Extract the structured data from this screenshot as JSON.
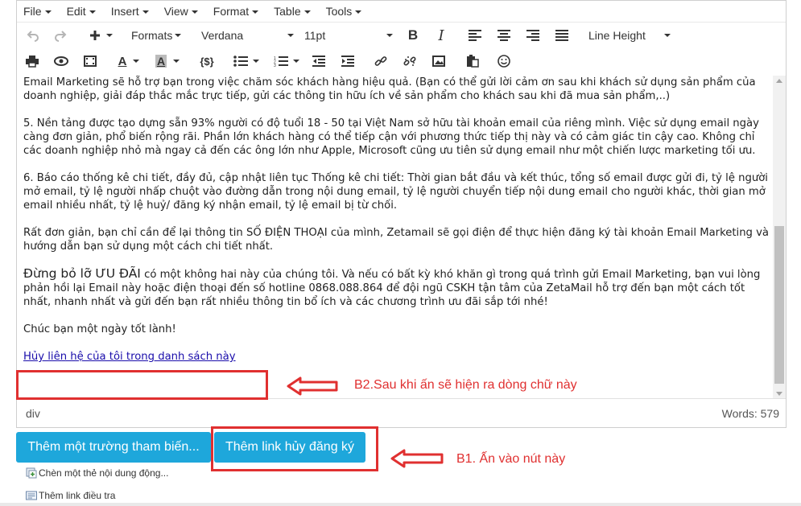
{
  "menubar": {
    "items": [
      "File",
      "Edit",
      "Insert",
      "View",
      "Format",
      "Table",
      "Tools"
    ]
  },
  "toolbar": {
    "formats_label": "Formats",
    "font_family": "Verdana",
    "font_size": "11pt",
    "line_height_label": "Line Height",
    "source_code_label": "{$}"
  },
  "content": {
    "p1": "Email Marketing sẽ hỗ trợ bạn trong việc chăm sóc khách hàng hiệu quả. (Bạn có thể gửi lời cảm ơn sau khi khách sử dụng sản phẩm của doanh nghiệp, giải đáp thắc mắc trực tiếp, gửi các thông tin hữu ích về sản phẩm cho khách sau khi đã mua sản phẩm,..)",
    "p2": "5. Nền tảng được tạo dựng sẵn 93% người có độ tuổi 18 - 50 tại Việt Nam sở hữu tài khoản email của riêng mình. Việc sử dụng email ngày càng đơn giản, phổ biến rộng rãi. Phần lớn khách hàng có thể tiếp cận với phương thức tiếp thị này và có cảm giác tin cậy cao. Không chỉ các doanh nghiệp nhỏ mà ngay cả đến các ông lớn như Apple, Microsoft cũng ưu tiên sử dụng email như một chiến lược marketing tối ưu.",
    "p3": "6. Báo cáo thống kê chi tiết, đầy đủ, cập nhật liên tục Thống kê chi tiết: Thời gian bắt đầu và kết thúc, tổng số email được gửi đi, tỷ lệ người mở email, tỷ lệ người nhấp chuột vào đường dẫn trong nội dung email, tỷ lệ người chuyển tiếp nội dung email cho người khác, thời gian mở email nhiều nhất, tỷ lệ huỷ/ đăng ký nhận email, tỷ lệ email bị từ chối.",
    "p4": "Rất đơn giản, bạn chỉ cần để lại thông tin SỐ ĐIỆN THOẠI của mình, Zetamail sẽ gọi điện để thực hiện đăng ký tài khoản Email Marketing và hướng dẫn bạn sử dụng một cách chi tiết nhất.",
    "p5_lead": "Đừng bỏ lỡ ƯU ĐÃI",
    "p5_rest": " có một không hai này của chúng tôi. Và nếu có bất kỳ khó khăn gì trong quá trình gửi Email Marketing, bạn vui lòng phản hồi lại Email này hoặc điện thoại đến số hotline 0868.088.864 để đội ngũ CSKH tận tâm của ZetaMail hỗ trợ đến bạn một cách tốt nhất, nhanh nhất và gửi đến bạn rất nhiều thông tin bổ ích và các chương trình ưu đãi sắp tới nhé!",
    "p6": "Chúc bạn một ngày tốt lành!",
    "unsubscribe_link": "Hủy liên hệ của tôi trong danh sách này"
  },
  "statusbar": {
    "path": "div",
    "word_count": "Words: 579"
  },
  "buttons": {
    "add_variable": "Thêm một trường tham biến...",
    "add_unsubscribe": "Thêm link hủy đăng ký"
  },
  "links": {
    "insert_dynamic": "Chèn một thẻ nội dung động...",
    "add_survey": "Thêm link điều tra"
  },
  "annotations": {
    "b2": "B2.Sau khi ấn sẽ hiện ra dòng chữ này",
    "b1": "B1. Ấn vào nút này"
  },
  "colors": {
    "button_blue": "#1ea7db",
    "annotation_red": "#e03030",
    "link_blue": "#1a0dab"
  },
  "icons": [
    "undo-icon",
    "redo-icon",
    "insert-plus-icon",
    "bold-icon",
    "italic-icon",
    "align-left-icon",
    "align-center-icon",
    "align-right-icon",
    "align-justify-icon",
    "print-icon",
    "preview-icon",
    "media-icon",
    "text-color-icon",
    "background-color-icon",
    "source-code-icon",
    "bullet-list-icon",
    "numbered-list-icon",
    "outdent-icon",
    "indent-icon",
    "link-icon",
    "unlink-icon",
    "image-icon",
    "paste-icon",
    "emoticon-icon",
    "scrollbar-up-arrow",
    "scrollbar-down-arrow",
    "insert-dynamic-icon",
    "survey-icon",
    "arrow-left-icon"
  ]
}
